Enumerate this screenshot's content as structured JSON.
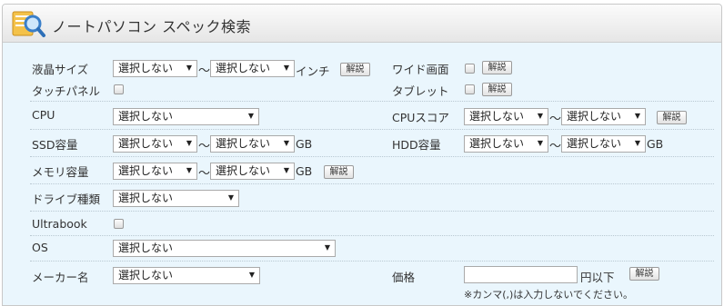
{
  "header": {
    "title": "ノートパソコン スペック検索",
    "icon": "magnifier-document-icon"
  },
  "colors": {
    "panel_bg": "#eaf6fd",
    "header_bg": "#e6e6e6",
    "icon_glass": "#3a7fc9",
    "icon_doc": "#f0b030"
  },
  "labels": {
    "screen": "液晶サイズ",
    "wide": "ワイド画面",
    "touch": "タッチパネル",
    "tablet": "タブレット",
    "cpu": "CPU",
    "cpu_score": "CPUスコア",
    "ssd": "SSD容量",
    "hdd": "HDD容量",
    "memory": "メモリ容量",
    "drive": "ドライブ種類",
    "ultrabook": "Ultrabook",
    "os": "OS",
    "maker": "メーカー名",
    "price": "価格"
  },
  "select_default": "選択しない",
  "tilde": "〜",
  "units": {
    "inch": "インチ",
    "gb": "GB",
    "price_suffix": "円以下"
  },
  "help_label": "解説",
  "price_note": "※カンマ(,)は入力しないでください。",
  "price_value": ""
}
